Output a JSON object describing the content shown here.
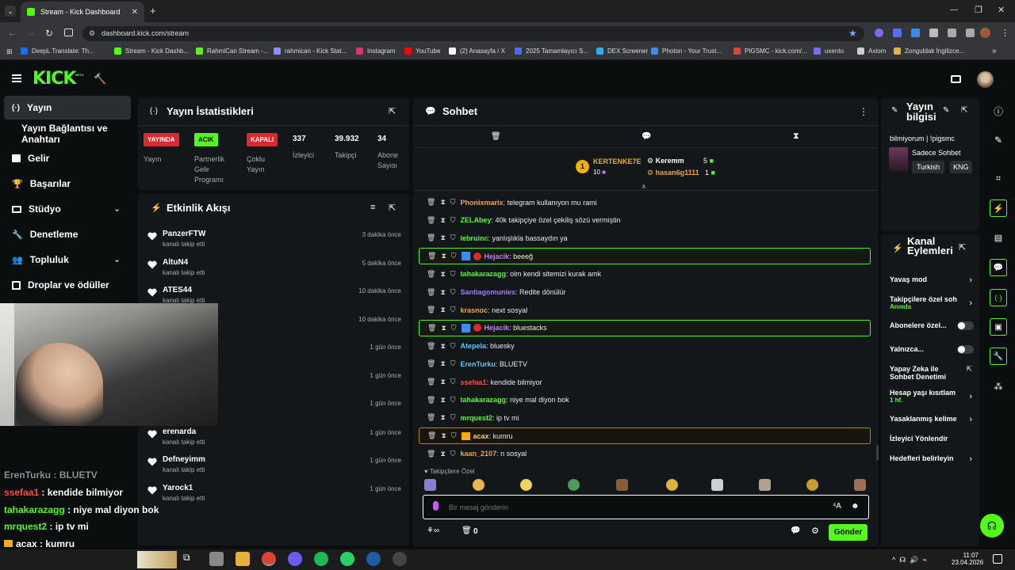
{
  "browser": {
    "tab_title": "Stream - Kick Dashboard",
    "url": "dashboard.kick.com/stream",
    "bookmarks": [
      "DeepL Translate: Th...",
      "Stream - Kick Dashb...",
      "RahmiCan Stream -...",
      "rahmican - Kick Stat...",
      "Instagram",
      "YouTube",
      "(2) Anasayfa / X",
      "2025 Tamamlayıcı S...",
      "DEX Screener",
      "Photon - Your Trust...",
      "PIGSMC - kick.com/...",
      "uxento",
      "Axiom",
      "Zonguldak İngilizce..."
    ]
  },
  "header": {
    "logo": "KICK",
    "beta": "BETA"
  },
  "sidebar": {
    "items": [
      "Yayın",
      "Yayın Bağlantısı ve Anahtarı",
      "Gelir",
      "Başarılar",
      "Stüdyo",
      "Denetleme",
      "Topluluk",
      "Droplar ve ödüller"
    ]
  },
  "stats": {
    "title": "Yayın İstatistikleri",
    "items": [
      {
        "badge": "YAYINDA",
        "label": "Yayın"
      },
      {
        "badge": "ACIK",
        "label": "Partnerlik Gelir Programı"
      },
      {
        "badge": "KAPALI",
        "label": "Çoklu Yayın"
      },
      {
        "value": "337",
        "label": "İzleyici"
      },
      {
        "value": "39.932",
        "label": "Takipçi"
      },
      {
        "value": "34",
        "label": "Abone Sayısı"
      }
    ]
  },
  "activity": {
    "title": "Etkinlik Akışı",
    "items": [
      {
        "name": "PanzerFTW",
        "sub": "kanalı takip etti",
        "time": "3 dakika önce"
      },
      {
        "name": "AltuN4",
        "sub": "kanalı takip etti",
        "time": "5 dakika önce"
      },
      {
        "name": "ATES44",
        "sub": "kanalı takip etti",
        "time": "10 dakika önce"
      },
      {
        "name": "dafi",
        "sub": "",
        "time": "10 dakika önce"
      },
      {
        "name": "",
        "sub": "",
        "time": "1 gün önce"
      },
      {
        "name": "",
        "sub": "",
        "time": "1 gün önce"
      },
      {
        "name": "",
        "sub": "",
        "time": "1 gün önce"
      },
      {
        "name": "erenarda",
        "sub": "kanalı takip etti",
        "time": "1 gün önce"
      },
      {
        "name": "Defneyimm",
        "sub": "kanalı takip etti",
        "time": "1 gün önce"
      },
      {
        "name": "Yarock1",
        "sub": "kanalı takip etti",
        "time": "1 gün önce"
      }
    ]
  },
  "chat": {
    "title": "Sohbet",
    "top": {
      "first": {
        "rank": "1",
        "name": "KERTENKE7E",
        "value": "10"
      },
      "second": {
        "name": "Keremm",
        "value": "5"
      },
      "third": {
        "name": "hasan6g1111",
        "value": "1"
      }
    },
    "messages": [
      {
        "user": "Phonixmarix",
        "color": "#f2a33a",
        "text": ": telegram kullanıyon mu rami"
      },
      {
        "user": "ZELAbey",
        "color": "#53fc18",
        "text": ": 40k takipçiye özel çekiliş sözü vermiştin"
      },
      {
        "user": "lebruinc",
        "color": "#53fc18",
        "text": ": yanlışlıkla bassaydın ya"
      },
      {
        "user": "Hejacik",
        "color": "#c27bff",
        "text": ": beeeğ",
        "hl": "green"
      },
      {
        "user": "tahakarazagg",
        "color": "#53fc18",
        "text": ": olm kendi sitemizi kurak amk"
      },
      {
        "user": "Santiagomunies",
        "color": "#a27bff",
        "text": ": Redite dönülür"
      },
      {
        "user": "krasnoc",
        "color": "#f2a33a",
        "text": ": next sosyal"
      },
      {
        "user": "Hejacik",
        "color": "#c27bff",
        "text": ": bluestacks",
        "hl": "green"
      },
      {
        "user": "Atepela",
        "color": "#5bc6ff",
        "text": ": bluesky"
      },
      {
        "user": "ErenTurku",
        "color": "#5bc6ff",
        "text": ": BLUETV"
      },
      {
        "user": "ssefaa1",
        "color": "#ff4b4b",
        "text": ": kendide bilmiyor"
      },
      {
        "user": "tahakarazagg",
        "color": "#53fc18",
        "text": ": niye mal diyon bok"
      },
      {
        "user": "mrquest2",
        "color": "#53fc18",
        "text": ": ip tv mi"
      },
      {
        "user": "acax",
        "color": "#f4d35e",
        "text": ": kumru",
        "hl": "gold"
      },
      {
        "user": "kaan_2107",
        "color": "#f2a33a",
        "text": ": n sosyal"
      }
    ],
    "emote_label": "Takipçilere Özel",
    "placeholder": "Bir mesaj gönderin",
    "points": "0",
    "send": "Gönder"
  },
  "overlay": [
    {
      "user": "ErenTurku",
      "color": "#8f9294",
      "text": " : BLUETV"
    },
    {
      "user": "ssefaa1",
      "color": "#ff4b4b",
      "text": " : kendide bilmiyor"
    },
    {
      "user": "tahakarazagg",
      "color": "#53fc18",
      "text": " : niye mal diyon bok"
    },
    {
      "user": "mrquest2",
      "color": "#53fc18",
      "text": " : ip tv mi"
    },
    {
      "user": "acax",
      "color": "#ffffff",
      "text": " : kumru"
    },
    {
      "user": "kaan_2107",
      "color": "#f2a33a",
      "text": "n sosyal"
    }
  ],
  "info": {
    "title": "Yayın bilgisi",
    "stream_title": "bilmiyorum | !pigsmc",
    "category": "Sadece Sohbet",
    "tags": [
      "Turkish",
      "KNG"
    ]
  },
  "channel": {
    "title": "Kanal Eylemleri",
    "items": [
      {
        "label": "Yavaş mod",
        "type": "arrow"
      },
      {
        "label": "Takipçilere özel soh",
        "sub": "Anında",
        "type": "arrow"
      },
      {
        "label": "Abonelere özel...",
        "type": "toggle"
      },
      {
        "label": "Yalnızca...",
        "type": "toggle"
      },
      {
        "label": "Yapay Zeka ile Sohbet Denetimi",
        "type": "ext"
      },
      {
        "label": "Hesap yaşı kısıtlam",
        "sub": "1 hf.",
        "type": "arrow"
      },
      {
        "label": "Yasaklanmış kelime",
        "type": "arrow"
      },
      {
        "label": "İzleyici Yönlendir",
        "type": "none"
      },
      {
        "label": "Hedefleri belirleyin",
        "type": "arrow"
      }
    ]
  },
  "taskbar": {
    "time": "11:07",
    "date": "23.04.2026"
  },
  "colors": {
    "accent": "#53fc18",
    "live": "#e0272d",
    "panel": "#141719"
  }
}
